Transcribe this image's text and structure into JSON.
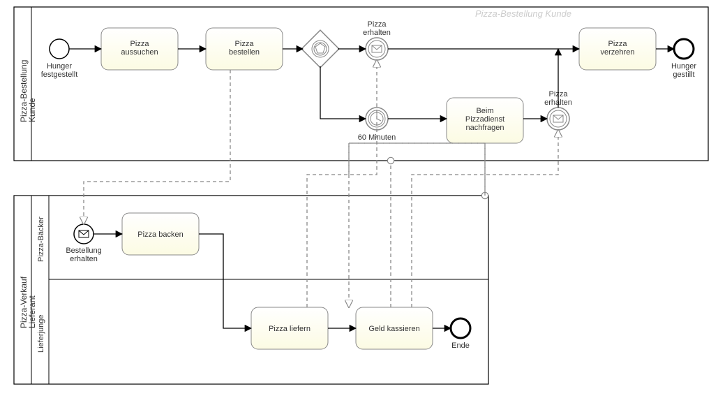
{
  "diagram_title": "Pizza-Bestellung Kunde",
  "pools": {
    "customer": {
      "name": "Pizza-Bestellung\nKunde"
    },
    "vendor": {
      "name": "Pizza-Verkauf\nLieferant",
      "lanes": {
        "baker": "Pizza-Bäcker",
        "courier": "Lieferjunge"
      }
    }
  },
  "events": {
    "start_hunger": {
      "label": "Hunger\nfestgestellt"
    },
    "msg_recv_top": {
      "label": "Pizza\nerhalten"
    },
    "timer": {
      "label": "60 Minuten"
    },
    "msg_recv_alt": {
      "label": "Pizza\nerhalten"
    },
    "end_hunger": {
      "label": "Hunger\ngestillt"
    },
    "order_received": {
      "label": "Bestellung\nerhalten"
    },
    "end_vendor": {
      "label": "Ende"
    }
  },
  "tasks": {
    "select": "Pizza\naussuchen",
    "order": "Pizza\nbestellen",
    "ask": "Beim\nPizzadienst\nnachfragen",
    "eat": "Pizza\nverzehren",
    "bake": "Pizza backen",
    "deliver": "Pizza liefern",
    "collect": "Geld kassieren"
  }
}
